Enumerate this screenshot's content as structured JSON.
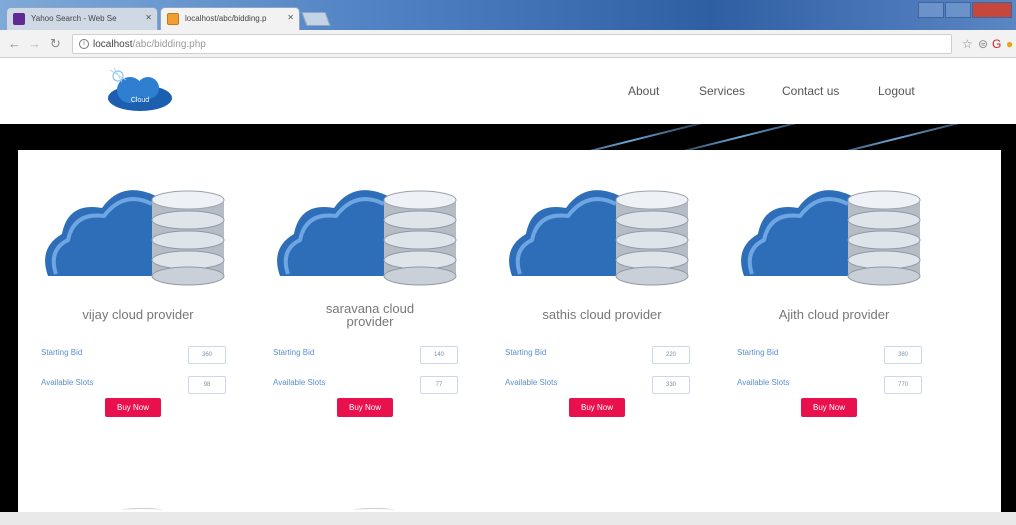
{
  "browser": {
    "tabs": [
      {
        "label": "Yahoo Search - Web Se",
        "active": false
      },
      {
        "label": "localhost/abc/bidding.p",
        "active": true
      }
    ],
    "url_host": "localhost",
    "url_path": "/abc/bidding.php"
  },
  "site": {
    "logo_text": "Cloud",
    "nav": [
      "About",
      "Services",
      "Contact us",
      "Logout"
    ]
  },
  "providers": [
    {
      "name": "vijay cloud provider",
      "starting_bid_label": "Starting Bid",
      "starting_bid": "360",
      "available_slots_label": "Available Slots",
      "available_slots": "98",
      "button": "Buy Now"
    },
    {
      "name": "saravana cloud provider",
      "starting_bid_label": "Starting Bid",
      "starting_bid": "140",
      "available_slots_label": "Available Slots",
      "available_slots": "77",
      "button": "Buy Now"
    },
    {
      "name": "sathis cloud provider",
      "starting_bid_label": "Starting Bid",
      "starting_bid": "220",
      "available_slots_label": "Available Slots",
      "available_slots": "330",
      "button": "Buy Now"
    },
    {
      "name": "Ajith cloud provider",
      "starting_bid_label": "Starting Bid",
      "starting_bid": "380",
      "available_slots_label": "Available Slots",
      "available_slots": "770",
      "button": "Buy Now"
    }
  ],
  "colors": {
    "buy_button": "#e8114d",
    "label_blue": "#5b8fcf",
    "cloud_blue": "#2e6db8"
  }
}
